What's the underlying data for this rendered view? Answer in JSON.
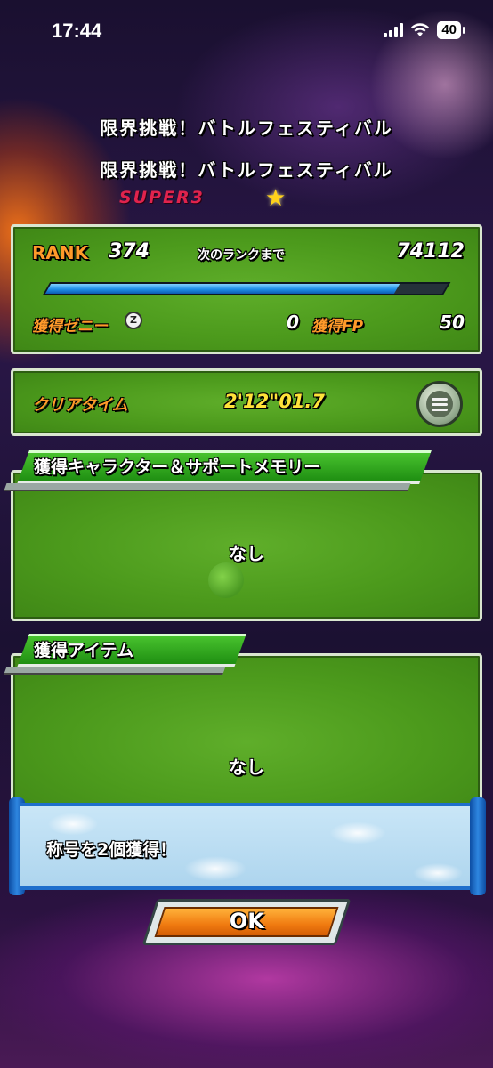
{
  "status_bar": {
    "time": "17:44",
    "battery": "40",
    "signal_icon": "cellular-signal-icon",
    "wifi_icon": "wifi-icon"
  },
  "header": {
    "title_primary": "限界挑戦！バトルフェスティバル",
    "title_secondary": "限界挑戦！バトルフェスティバル",
    "difficulty": "SUPER3",
    "star_icon": "star-icon"
  },
  "rank_panel": {
    "rank_label": "RANK",
    "rank_value": "374",
    "next_rank_label": "次のランクまで",
    "next_rank_value": "74112",
    "progress_fraction": 0.88,
    "zeni_label": "獲得ゼニー",
    "zeni_icon": "zeni-coin-icon",
    "zeni_value": "0",
    "fp_label": "獲得FP",
    "fp_value": "50"
  },
  "clear_panel": {
    "clear_time_label": "クリアタイム",
    "clear_time_value": "2'12\"01.7",
    "details_icon": "list-icon"
  },
  "characters_section": {
    "header": "獲得キャラクター＆サポートメモリー",
    "empty_text": "なし"
  },
  "items_section": {
    "header": "獲得アイテム",
    "empty_text": "なし"
  },
  "message": {
    "text": "称号を2個獲得！"
  },
  "ok_button": {
    "label": "OK"
  },
  "colors": {
    "panel_green": "#4c9a1c",
    "progress_blue": "#1f8fe8",
    "accent_orange": "#ff9a2a",
    "clear_time_yellow": "#ffe23a",
    "super_red": "#e0234d"
  }
}
